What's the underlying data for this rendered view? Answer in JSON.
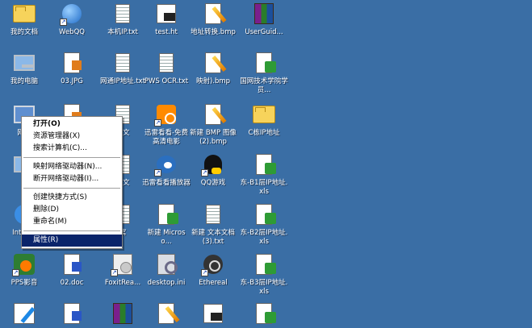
{
  "desktop": {
    "background": "#3a6ea5",
    "icons": [
      {
        "label": "我的文档",
        "kind": "folder",
        "shortcut": false
      },
      {
        "label": "WebQQ",
        "kind": "globe",
        "shortcut": true
      },
      {
        "label": "本机IP.txt",
        "kind": "txt",
        "shortcut": false
      },
      {
        "label": "test.ht",
        "kind": "ht",
        "shortcut": false
      },
      {
        "label": "地址转换.bmp",
        "kind": "bmp",
        "shortcut": false
      },
      {
        "label": "UserGuid...",
        "kind": "rar",
        "shortcut": false
      },
      {
        "label": "我的电脑",
        "kind": "pc",
        "shortcut": false
      },
      {
        "label": "03.JPG",
        "kind": "jpg",
        "shortcut": false
      },
      {
        "label": "网通IP地址.txt",
        "kind": "txt",
        "shortcut": false
      },
      {
        "label": "PWS OCR.txt",
        "kind": "txt",
        "shortcut": false
      },
      {
        "label": "映射).bmp",
        "kind": "bmp",
        "shortcut": false
      },
      {
        "label": "国网技术学院学员...",
        "kind": "xls",
        "shortcut": false
      },
      {
        "label": "网上",
        "kind": "net",
        "shortcut": false
      },
      {
        "label": "",
        "kind": "jpg",
        "shortcut": false
      },
      {
        "label": "本文",
        "kind": "txt",
        "shortcut": false
      },
      {
        "label": "迅雷看看-免费高清电影",
        "kind": "xunlei",
        "shortcut": true
      },
      {
        "label": "新建 BMP 图像 (2).bmp",
        "kind": "bmp",
        "shortcut": false
      },
      {
        "label": "C栋IP地址",
        "kind": "folder",
        "shortcut": false
      },
      {
        "label": "回",
        "kind": "pc",
        "shortcut": false
      },
      {
        "label": "",
        "kind": "txt",
        "shortcut": false
      },
      {
        "label": "本文",
        "kind": "txt",
        "shortcut": false
      },
      {
        "label": "迅雷看看播放器",
        "kind": "bird",
        "shortcut": true
      },
      {
        "label": "QQ游戏",
        "kind": "qq",
        "shortcut": true
      },
      {
        "label": "东-B1层IP地址.xls",
        "kind": "xls",
        "shortcut": false
      },
      {
        "label": "Int Exp",
        "kind": "ie",
        "shortcut": false
      },
      {
        "label": "寓",
        "kind": "txt",
        "shortcut": false
      },
      {
        "label": "新建 Microso...",
        "kind": "xls",
        "shortcut": false
      },
      {
        "label": "新建 文本文档 (3).txt",
        "kind": "txt",
        "shortcut": false
      },
      {
        "label": "东-B2层IP地址.xls",
        "kind": "xls",
        "shortcut": false
      },
      {
        "label": "PPS影音",
        "kind": "pps",
        "shortcut": true
      },
      {
        "label": "02.doc",
        "kind": "doc",
        "shortcut": false
      },
      {
        "label": "FoxitRea...",
        "kind": "foxit",
        "shortcut": true
      },
      {
        "label": "desktop.ini",
        "kind": "ini",
        "shortcut": false
      },
      {
        "label": "Ethereal",
        "kind": "ether",
        "shortcut": true
      },
      {
        "label": "东-B3层IP地址.xls",
        "kind": "xls",
        "shortcut": false
      },
      {
        "label": "",
        "kind": "pen",
        "shortcut": false
      },
      {
        "label": "",
        "kind": "doc",
        "shortcut": false
      },
      {
        "label": "",
        "kind": "rar",
        "shortcut": false
      },
      {
        "label": "",
        "kind": "bmp",
        "shortcut": false
      },
      {
        "label": "",
        "kind": "ht",
        "shortcut": false
      },
      {
        "label": "",
        "kind": "xls",
        "shortcut": false
      }
    ]
  },
  "context_menu": {
    "items": [
      {
        "label": "打开(O)",
        "bold": true,
        "selected": false
      },
      {
        "label": "资源管理器(X)",
        "bold": false,
        "selected": false
      },
      {
        "label": "搜索计算机(C)...",
        "bold": false,
        "selected": false
      },
      {
        "separator": true
      },
      {
        "label": "映射网络驱动器(N)...",
        "bold": false,
        "selected": false
      },
      {
        "label": "断开网络驱动器(I)...",
        "bold": false,
        "selected": false
      },
      {
        "separator": true
      },
      {
        "label": "创建快捷方式(S)",
        "bold": false,
        "selected": false
      },
      {
        "label": "删除(D)",
        "bold": false,
        "selected": false
      },
      {
        "label": "重命名(M)",
        "bold": false,
        "selected": false
      },
      {
        "separator": true
      },
      {
        "label": "属性(R)",
        "bold": false,
        "selected": true
      }
    ]
  }
}
